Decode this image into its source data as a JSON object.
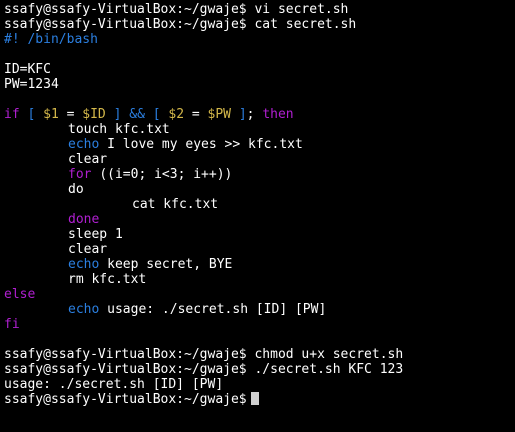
{
  "terminal": {
    "prompt": "ssafy@ssafy-VirtualBox:~/gwaje$",
    "cmd1": "vi secret.sh",
    "cmd2": "cat secret.sh",
    "shebang": "#! /bin/bash",
    "id_assign": "ID=KFC",
    "pw_assign": "PW=1234",
    "if_kw": "if",
    "bracket_open": "[",
    "arg1": "$1",
    "eq": "=",
    "var_id": "$ID",
    "bracket_close": "]",
    "and_op": "&&",
    "arg2": "$2",
    "var_pw": "$PW",
    "semicolon": ";",
    "then_kw": "then",
    "touch_cmd": "touch kfc.txt",
    "echo_kw": "echo",
    "echo1_text": "I love my eyes >> kfc.txt",
    "clear1": "clear",
    "for_kw": "for",
    "for_cond": "((i=0; i<3; i++))",
    "do_kw": "do",
    "cat_cmd": "cat kfc.txt",
    "done_kw": "done",
    "sleep_cmd": "sleep 1",
    "clear2": "clear",
    "echo2_text": "keep secret, BYE",
    "rm_cmd": "rm kfc.txt",
    "else_kw": "else",
    "echo3_text": "usage: ./secret.sh [ID] [PW]",
    "fi_kw": "fi",
    "cmd3": "chmod u+x secret.sh",
    "cmd4": "./secret.sh KFC 123",
    "output1": "usage: ./secret.sh [ID] [PW]"
  },
  "colors": {
    "keyword": "#b01fd1",
    "builtin": "#2b7fe0",
    "variable": "#d4b84a",
    "text": "#ffffff",
    "background": "#000000"
  }
}
